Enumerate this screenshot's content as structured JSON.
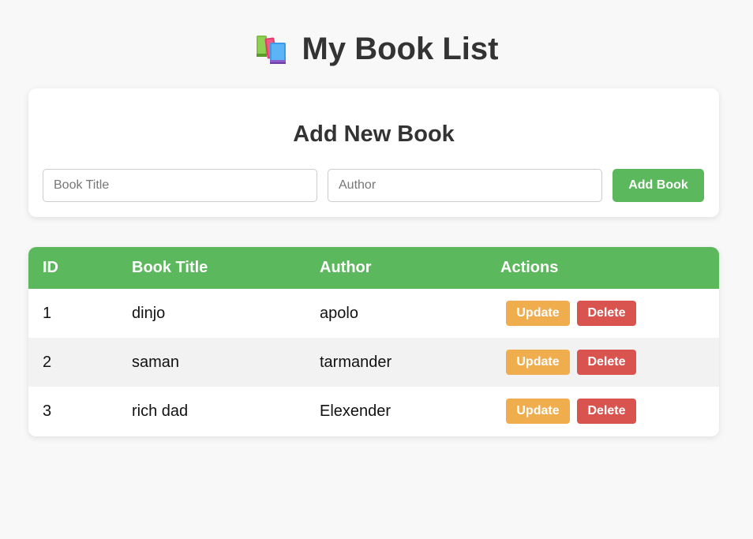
{
  "header": {
    "title": "My Book List",
    "icon": "books-icon"
  },
  "form": {
    "title": "Add New Book",
    "title_placeholder": "Book Title",
    "author_placeholder": "Author",
    "title_value": "",
    "author_value": "",
    "add_label": "Add Book"
  },
  "table": {
    "columns": [
      "ID",
      "Book Title",
      "Author",
      "Actions"
    ],
    "rows": [
      {
        "id": "1",
        "title": "dinjo",
        "author": "apolo",
        "update_label": "Update",
        "delete_label": "Delete"
      },
      {
        "id": "2",
        "title": "saman",
        "author": "tarmander",
        "update_label": "Update",
        "delete_label": "Delete"
      },
      {
        "id": "3",
        "title": "rich dad",
        "author": "Elexender",
        "update_label": "Update",
        "delete_label": "Delete"
      }
    ]
  },
  "colors": {
    "background": "#f8f8f8",
    "primary_green": "#5cb85c",
    "update_orange": "#f0ad4e",
    "delete_red": "#d9534f",
    "alt_row": "#f2f2f2"
  }
}
